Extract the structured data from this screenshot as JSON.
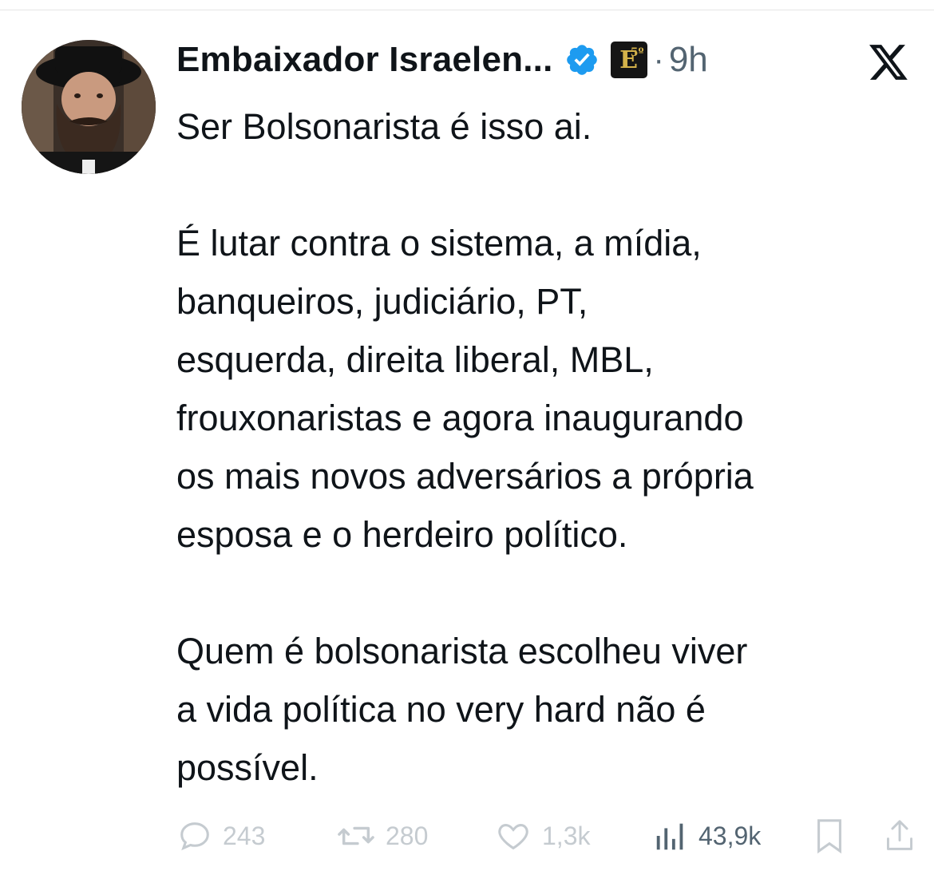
{
  "tweet": {
    "author": {
      "display_name": "Embaixador Israelen...",
      "verified_icon": "verified-badge-icon",
      "affiliate_badge_letter": "E",
      "affiliate_badge_sup": "5º"
    },
    "separator": "·",
    "time": "9h",
    "platform_logo": "x-logo-icon",
    "text": "Ser Bolsonarista é isso ai.\n\nÉ lutar contra o sistema, a mídia,\nbanqueiros, judiciário, PT,\nesquerda, direita liberal, MBL,\nfrouxonaristas e agora inaugurando\nos mais novos adversários a própria\nesposa e o herdeiro político.\n\nQuem é bolsonarista escolheu viver\na vida política no very hard não é\npossível.",
    "actions": {
      "replies": "243",
      "retweets": "280",
      "likes": "1,3k",
      "views": "43,9k"
    }
  },
  "colors": {
    "text": "#0f1419",
    "secondary": "#536471",
    "faded": "#c5cbd0",
    "verified": "#1d9bf0"
  }
}
